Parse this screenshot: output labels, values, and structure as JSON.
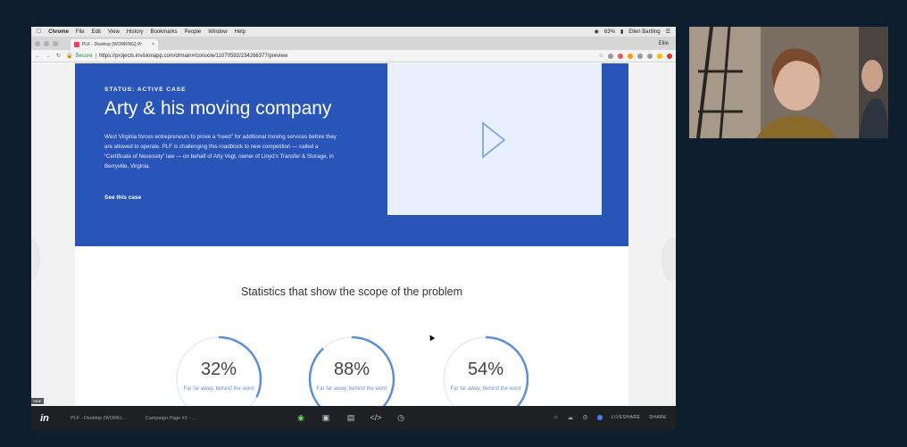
{
  "menubar": {
    "app": "Chrome",
    "items": [
      "File",
      "Edit",
      "View",
      "History",
      "Bookmarks",
      "People",
      "Window",
      "Help"
    ],
    "battery": "63%",
    "user": "Ellen Bartling"
  },
  "browser": {
    "tab_title": "PLF - Desktop [WORKING] Pr",
    "tab_close": "×",
    "profile": "Ellie",
    "secure_label": "Secure",
    "url": "https://projects.invisionapp.com/d/main#/console/11070592/234266377/preview"
  },
  "hero": {
    "status": "STATUS: ACTIVE CASE",
    "title": "Arty & his moving company",
    "body": "West Virginia forces entrepreneurs to prove a “need” for additional moving services before they are allowed to operate. PLF is challenging this roadblock to new competition — called a “Certificate of Necessity” law — on behalf of Arty Vogt, owner of Lloyd’s Transfer & Storage, in Berryville, Virginia.",
    "link": "See this case"
  },
  "stats": {
    "title": "Statistics that show the scope of the problem",
    "items": [
      {
        "value": "32%",
        "caption": "Far far away, behind the word"
      },
      {
        "value": "88%",
        "caption": "Far far away, behind the word"
      },
      {
        "value": "54%",
        "caption": "Far far away, behind the word"
      }
    ]
  },
  "invision_bar": {
    "hide_label": "HIDE",
    "logo": "in",
    "project": "PLF - Desktop (WORKI...",
    "screen": "Campaign Page #1 - ...",
    "liveshare": "LIVESHARE",
    "share": "SHARE"
  }
}
